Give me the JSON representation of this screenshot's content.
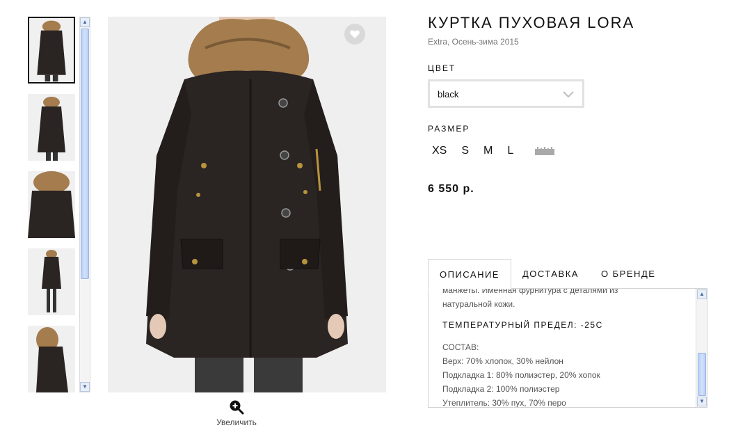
{
  "product": {
    "title": "КУРТКА ПУХОВАЯ LORA",
    "subtitle": "Extra, Осень-зима 2015",
    "price": "6 550 р."
  },
  "color": {
    "label": "ЦВЕТ",
    "selected": "black"
  },
  "size": {
    "label": "РАЗМЕР",
    "options": [
      "XS",
      "S",
      "M",
      "L"
    ],
    "ruler_icon": "ruler-icon"
  },
  "gallery": {
    "zoom_label": "Увеличить",
    "thumbnail_count": 5,
    "active_thumbnail": 0,
    "favorite_icon": "heart-icon"
  },
  "tabs": [
    {
      "label": "ОПИСАНИЕ",
      "active": true
    },
    {
      "label": "ДОСТАВКА",
      "active": false
    },
    {
      "label": "О БРЕНДЕ",
      "active": false
    }
  ],
  "description": {
    "line1": "манжеты. Именная фурнитура с деталями из",
    "line2": "натуральной кожи.",
    "temp_heading": "ТЕМПЕРАТУРНЫЙ ПРЕДЕЛ: -25С",
    "composition_heading": "СОСТАВ:",
    "composition": [
      "Верх: 70% хлопок, 30% нейлон",
      "Подкладка 1: 80% полиэстер, 20% хопок",
      "Подкладка 2: 100% полиэстер",
      "Утеплитель: 30% пух, 70% перо"
    ]
  },
  "colors": {
    "text": "#111111",
    "muted": "#777777",
    "border": "#d4d4d4",
    "scrollbar": "#b9cef5",
    "jacket": "#2a2422",
    "fur": "#a47c4e"
  }
}
